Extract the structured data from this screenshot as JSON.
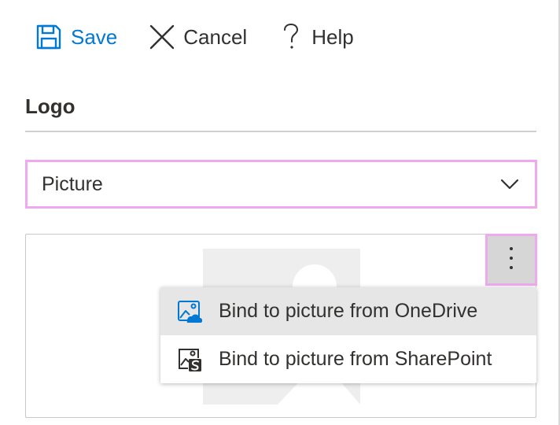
{
  "toolbar": {
    "save_label": "Save",
    "cancel_label": "Cancel",
    "help_label": "Help"
  },
  "section": {
    "title": "Logo"
  },
  "dropdown": {
    "selected": "Picture"
  },
  "menu": {
    "items": [
      {
        "label": "Bind to picture from OneDrive",
        "icon": "onedrive-picture-icon",
        "highlighted": true
      },
      {
        "label": "Bind to picture from SharePoint",
        "icon": "sharepoint-picture-icon",
        "highlighted": false
      }
    ]
  },
  "colors": {
    "accent": "#0078d4",
    "focus_outline": "#f0a9ef",
    "text": "#323130",
    "hover": "#e6e6e6"
  }
}
